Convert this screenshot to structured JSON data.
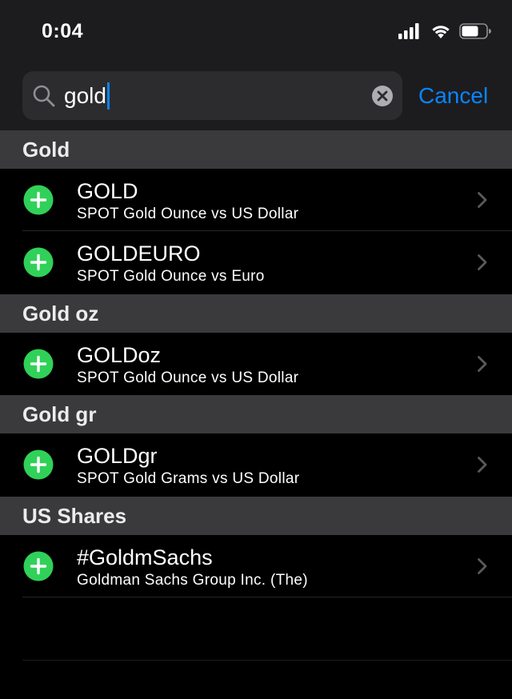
{
  "status_bar": {
    "time": "0:04",
    "icons": [
      "cellular-signal-icon",
      "wifi-icon",
      "battery-icon"
    ]
  },
  "search": {
    "value": "gold",
    "cancel_label": "Cancel"
  },
  "sections": [
    {
      "header": "Gold",
      "items": [
        {
          "symbol": "GOLD",
          "description": "SPOT Gold Ounce vs US Dollar"
        },
        {
          "symbol": "GOLDEURO",
          "description": "SPOT Gold Ounce vs Euro"
        }
      ]
    },
    {
      "header": "Gold oz",
      "items": [
        {
          "symbol": "GOLDoz",
          "description": "SPOT Gold Ounce vs US Dollar"
        }
      ]
    },
    {
      "header": "Gold gr",
      "items": [
        {
          "symbol": "GOLDgr",
          "description": "SPOT Gold Grams vs US Dollar"
        }
      ]
    },
    {
      "header": "US Shares",
      "items": [
        {
          "symbol": "#GoldmSachs",
          "description": "Goldman Sachs Group Inc. (The)"
        }
      ]
    }
  ],
  "colors": {
    "accent": "#0a84ff",
    "add": "#30d158",
    "header_bg": "#3a3a3c",
    "bar_bg": "#1c1c1e",
    "background": "#000000"
  }
}
